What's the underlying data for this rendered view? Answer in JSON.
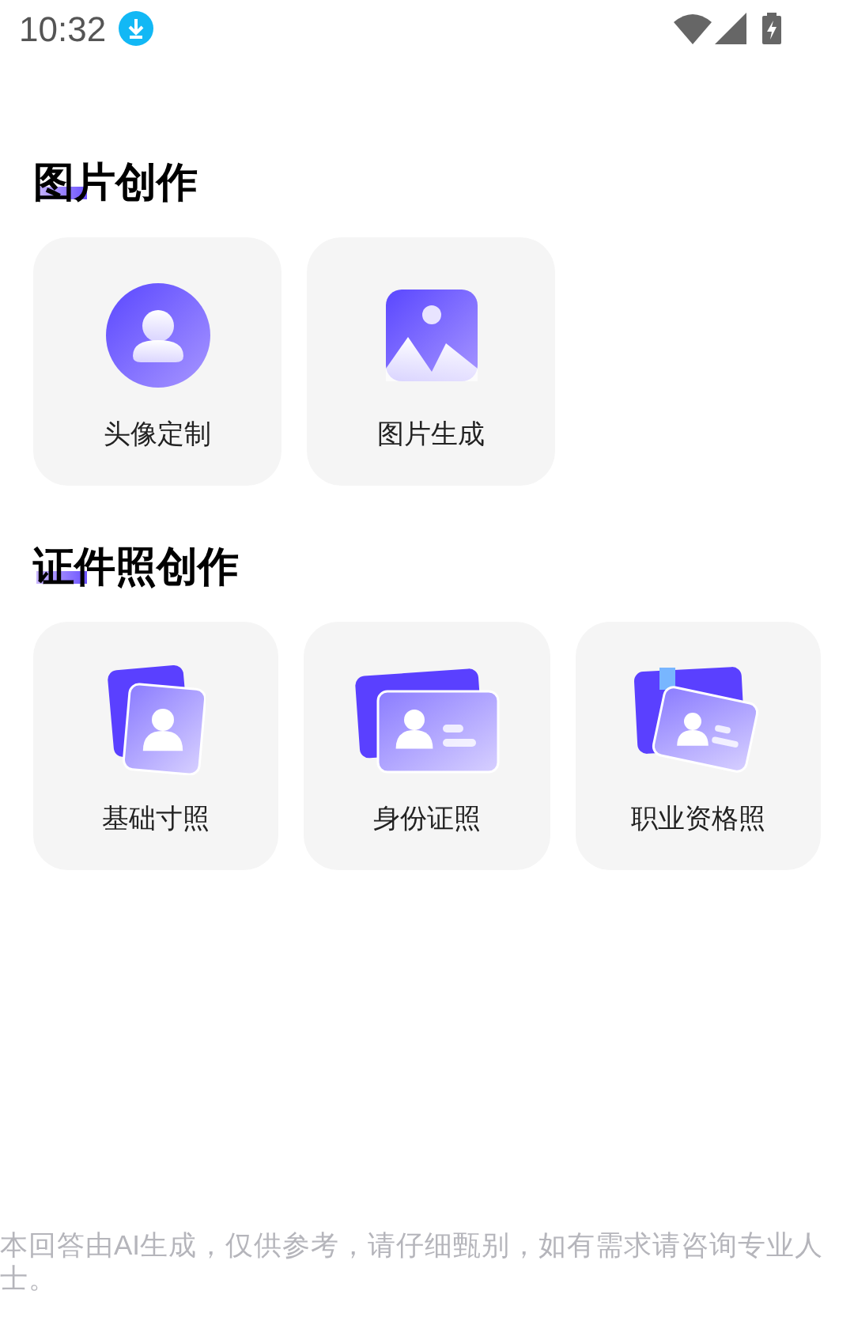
{
  "status_bar": {
    "time": "10:32"
  },
  "sections": [
    {
      "title": "图片创作",
      "items": [
        {
          "kind": "avatar",
          "label": "头像定制"
        },
        {
          "kind": "image",
          "label": "图片生成"
        }
      ]
    },
    {
      "title": "证件照创作",
      "items": [
        {
          "kind": "photo",
          "label": "基础寸照"
        },
        {
          "kind": "idcard",
          "label": "身份证照"
        },
        {
          "kind": "certificate",
          "label": "职业资格照"
        }
      ]
    }
  ],
  "disclaimer": "本回答由AI生成，仅供参考，请仔细甄别，如有需求请咨询专业人士。"
}
